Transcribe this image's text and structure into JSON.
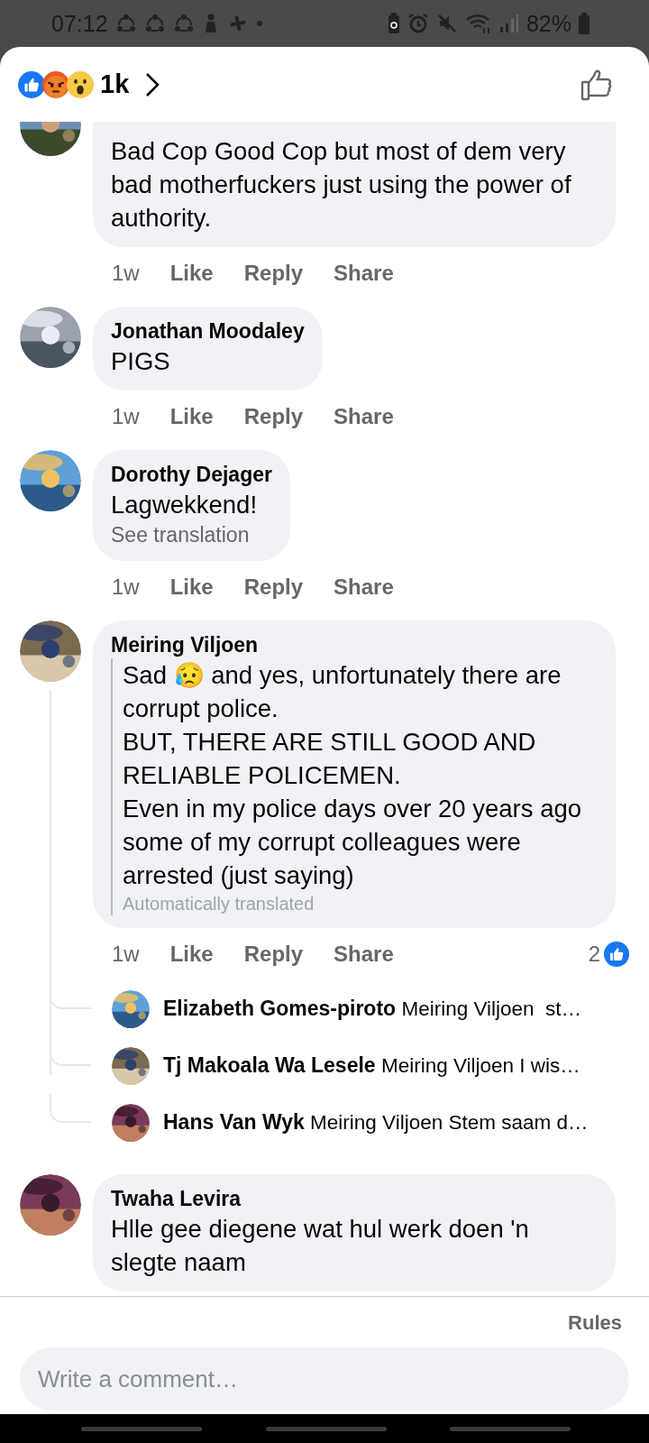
{
  "status_bar": {
    "time": "07:12",
    "battery": "82%"
  },
  "header": {
    "reaction_count": "1k"
  },
  "comments": [
    {
      "text": "Bad Cop Good Cop but most of dem very bad motherfuckers just using the power of authority.",
      "time": "1w",
      "actions": [
        "Like",
        "Reply",
        "Share"
      ]
    },
    {
      "author": "Jonathan Moodaley",
      "text": "PIGS",
      "time": "1w",
      "actions": [
        "Like",
        "Reply",
        "Share"
      ]
    },
    {
      "author": "Dorothy Dejager",
      "text": "Lagwekkend!",
      "link": "See translation",
      "time": "1w",
      "actions": [
        "Like",
        "Reply",
        "Share"
      ]
    },
    {
      "author": "Meiring Viljoen",
      "text": "Sad 😥 and yes, unfortunately there are corrupt police.\nBUT, THERE ARE STILL GOOD AND RELIABLE POLICEMEN.\nEven in my police days over 20 years ago some of my corrupt colleagues were arrested (just saying)",
      "note": "Automatically translated",
      "time": "1w",
      "actions": [
        "Like",
        "Reply",
        "Share"
      ],
      "likes": "2",
      "replies": [
        {
          "author": "Elizabeth Gomes-piroto",
          "text": "Meiring Viljoen  st…"
        },
        {
          "author": "Tj Makoala Wa Lesele",
          "text": "Meiring Viljoen I wis…"
        },
        {
          "author": "Hans Van Wyk",
          "text": "Meiring Viljoen Stem saam d…"
        }
      ]
    },
    {
      "author": "Twaha Levira",
      "text": "Hlle gee diegene wat hul werk doen 'n slegte naam"
    }
  ],
  "footer": {
    "rules": "Rules",
    "placeholder": "Write a comment…"
  }
}
